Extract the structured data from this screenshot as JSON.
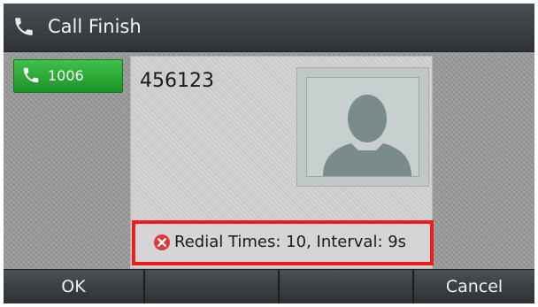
{
  "title_bar": {
    "title": "Call Finish",
    "icon": "phone-handset-icon"
  },
  "line_key": {
    "label": "1006",
    "icon": "phone-handset-icon",
    "color": "#2aa634"
  },
  "call_panel": {
    "number": "456123",
    "avatar": "person-silhouette-icon"
  },
  "status": {
    "text": "Redial Times: 10, Interval: 9s",
    "icon": "error-x-icon",
    "icon_color": "#e03a3a",
    "highlight_color": "#ee1c1c"
  },
  "softkeys": {
    "k1": "OK",
    "k2": "",
    "k3": "",
    "k4": "Cancel"
  }
}
